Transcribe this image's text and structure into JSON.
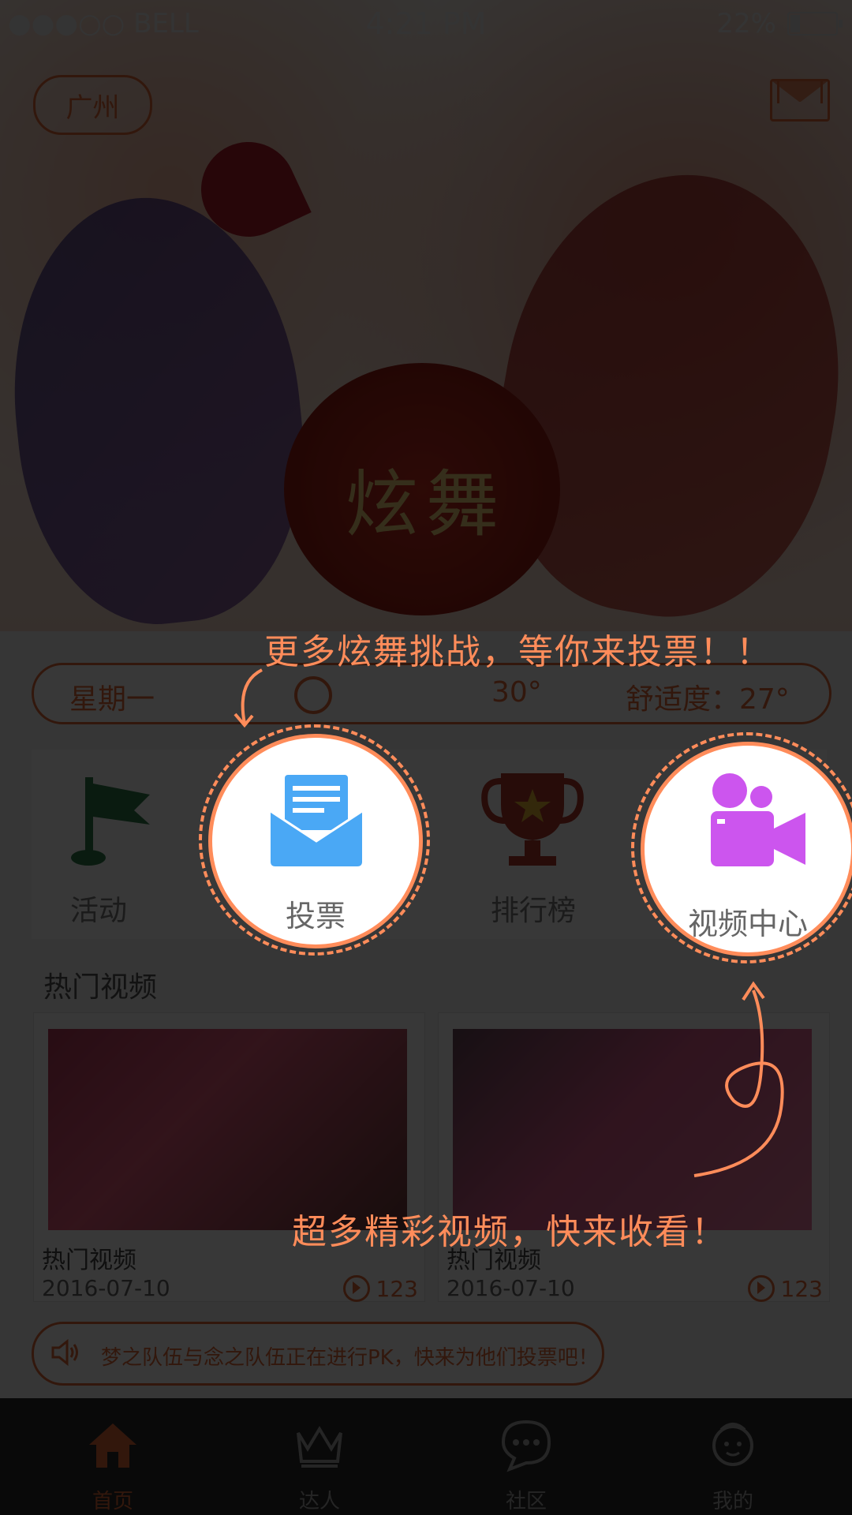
{
  "status": {
    "carrier": "●●●○○ BELL",
    "time": "4:21 PM",
    "battery": "22%",
    "battery_level": 0.22
  },
  "header": {
    "city": "广州"
  },
  "banner": {
    "logo_text": "炫舞"
  },
  "weather": {
    "day": "星期一",
    "temp": "30°",
    "comfort": "舒适度：27°"
  },
  "quick_menu": {
    "items": [
      {
        "label": "活动"
      },
      {
        "label": "投票"
      },
      {
        "label": "排行榜"
      },
      {
        "label": "视频中心"
      }
    ]
  },
  "section": {
    "title": "热门视频"
  },
  "videos": [
    {
      "title": "热门视频",
      "date": "2016-07-10",
      "views": "123"
    },
    {
      "title": "热门视频",
      "date": "2016-07-10",
      "views": "123"
    }
  ],
  "notice": {
    "text": "梦之队伍与念之队伍正在进行PK，快来为他们投票吧！"
  },
  "tabs": [
    {
      "label": "首页"
    },
    {
      "label": "达人"
    },
    {
      "label": "社区"
    },
    {
      "label": "我的"
    }
  ],
  "guide": {
    "vote_tip": "更多炫舞挑战，等你来投票！！",
    "video_tip": "超多精彩视频，快来收看！"
  },
  "colors": {
    "accent": "#e36b3a",
    "highlight": "#ff8c5a",
    "vote_icon": "#4aa8f5",
    "video_icon": "#cc55ee"
  }
}
